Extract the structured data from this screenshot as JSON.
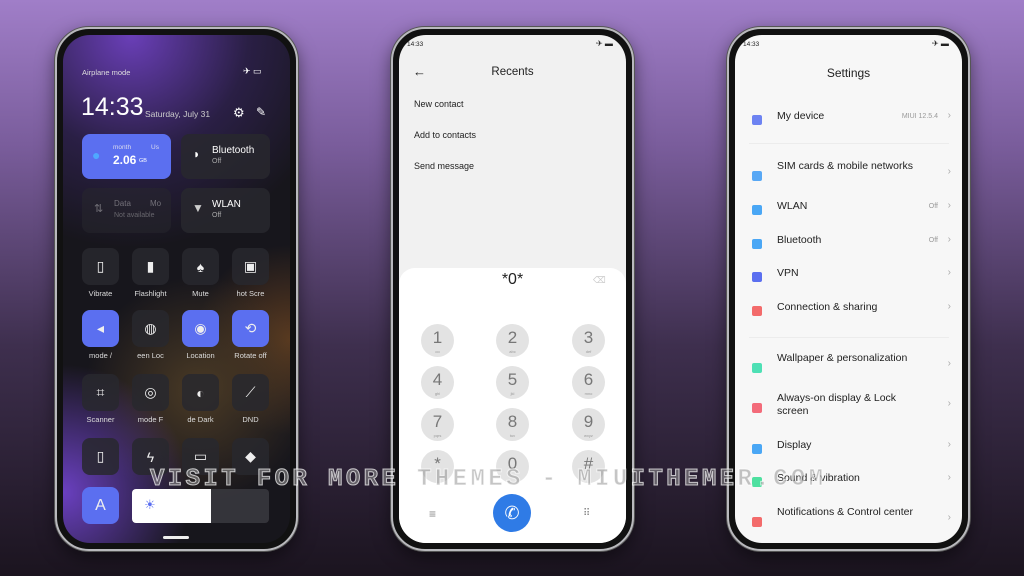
{
  "control_center": {
    "status_text": "Airplane mode",
    "time": "14:33",
    "date": "Saturday, July 31",
    "data_tile": {
      "label_a": "month",
      "label_b": "Us",
      "value": "2.06",
      "unit": "GB"
    },
    "bluetooth_tile": {
      "title": "Bluetooth",
      "state": "Off"
    },
    "mobile_data_tile": {
      "label_a": "Data",
      "label_b": "Mo",
      "state": "Not available"
    },
    "wlan_tile": {
      "title": "WLAN",
      "state": "Off"
    },
    "toggles": [
      {
        "label": "Vibrate",
        "icon": "vibrate-icon",
        "on": false
      },
      {
        "label": "Flashlight",
        "icon": "flashlight-icon",
        "on": false
      },
      {
        "label": "Mute",
        "icon": "bell-icon",
        "on": false
      },
      {
        "label": "hot   Scre",
        "icon": "screenshot-icon",
        "on": false
      },
      {
        "label": "mode   /",
        "icon": "airplane-icon",
        "on": true
      },
      {
        "label": "een   Loc",
        "icon": "fingerprint-icon",
        "on": false
      },
      {
        "label": "Location",
        "icon": "location-icon",
        "on": true
      },
      {
        "label": "Rotate off",
        "icon": "rotate-icon",
        "on": true
      },
      {
        "label": "Scanner",
        "icon": "scanner-icon",
        "on": false
      },
      {
        "label": "mode   F",
        "icon": "reading-mode-icon",
        "on": false
      },
      {
        "label": "de   Dark",
        "icon": "dark-mode-icon",
        "on": false
      },
      {
        "label": "DND",
        "icon": "dnd-icon",
        "on": false
      },
      {
        "label": "",
        "icon": "battery-saver-icon",
        "on": false
      },
      {
        "label": "",
        "icon": "lightning-icon",
        "on": false
      },
      {
        "label": "",
        "icon": "cast-icon",
        "on": false
      },
      {
        "label": "",
        "icon": "direction-icon",
        "on": false
      }
    ],
    "auto_brightness_label": "A",
    "brightness_level": 0.5,
    "accent": "#5b6ff0"
  },
  "dialer": {
    "status_time": "14:33",
    "title": "Recents",
    "options": [
      "New contact",
      "Add to contacts",
      "Send message"
    ],
    "number": "*0*",
    "keys": [
      {
        "d": "1",
        "l": "oo"
      },
      {
        "d": "2",
        "l": "abc"
      },
      {
        "d": "3",
        "l": "def"
      },
      {
        "d": "4",
        "l": "ghi"
      },
      {
        "d": "5",
        "l": "jkl"
      },
      {
        "d": "6",
        "l": "mno"
      },
      {
        "d": "7",
        "l": "pqrs"
      },
      {
        "d": "8",
        "l": "tuv"
      },
      {
        "d": "9",
        "l": "wxyz"
      },
      {
        "d": "*",
        "l": ""
      },
      {
        "d": "0",
        "l": ""
      },
      {
        "d": "#",
        "l": ""
      }
    ],
    "call_color": "#2f7be6"
  },
  "settings": {
    "status_time": "14:33",
    "title": "Settings",
    "items": [
      {
        "label": "My device",
        "value": "MIUI 12.5.4",
        "color": "#6d83f2"
      },
      {
        "label": "SIM cards & mobile networks",
        "value": "",
        "color": "#58a8f5"
      },
      {
        "label": "WLAN",
        "value": "Off",
        "color": "#4aa7f5"
      },
      {
        "label": "Bluetooth",
        "value": "Off",
        "color": "#4aa7f5"
      },
      {
        "label": "VPN",
        "value": "",
        "color": "#5b6ff0"
      },
      {
        "label": "Connection & sharing",
        "value": "",
        "color": "#f36b6b"
      },
      {
        "label": "Wallpaper & personalization",
        "value": "",
        "color": "#4ee0b5"
      },
      {
        "label": "Always-on display & Lock screen",
        "value": "",
        "color": "#f36b7a"
      },
      {
        "label": "Display",
        "value": "",
        "color": "#4aa7f5"
      },
      {
        "label": "Sound & vibration",
        "value": "",
        "color": "#4ee0a0"
      },
      {
        "label": "Notifications & Control center",
        "value": "",
        "color": "#f36b6b"
      }
    ]
  },
  "watermark": "VISIT FOR MORE THEMES - MIUITHEMER.COM"
}
